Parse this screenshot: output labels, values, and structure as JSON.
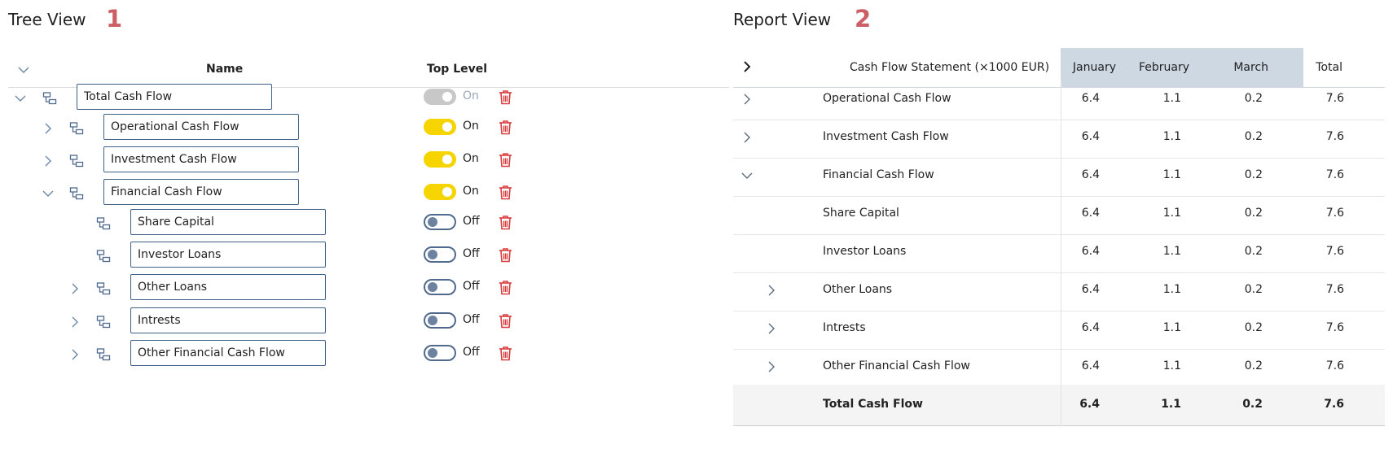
{
  "tree_view": {
    "title": "Tree View",
    "number": "1",
    "header": {
      "name": "Name",
      "top_level": "Top Level"
    },
    "rows": [
      {
        "label": "Total Cash Flow",
        "depth": 0,
        "chevron": "chevron-down",
        "toggle": "disabled",
        "toggle_label": "On"
      },
      {
        "label": "Operational Cash Flow",
        "depth": 1,
        "chevron": "chevron-right",
        "toggle": "on",
        "toggle_label": "On"
      },
      {
        "label": "Investment Cash Flow",
        "depth": 1,
        "chevron": "chevron-right",
        "toggle": "on",
        "toggle_label": "On"
      },
      {
        "label": "Financial Cash Flow",
        "depth": 1,
        "chevron": "chevron-down",
        "toggle": "on",
        "toggle_label": "On"
      },
      {
        "label": "Share Capital",
        "depth": 2,
        "chevron": "none",
        "toggle": "off",
        "toggle_label": "Off"
      },
      {
        "label": "Investor Loans",
        "depth": 2,
        "chevron": "none",
        "toggle": "off",
        "toggle_label": "Off"
      },
      {
        "label": "Other Loans",
        "depth": 2,
        "chevron": "chevron-right",
        "toggle": "off",
        "toggle_label": "Off"
      },
      {
        "label": "Intrests",
        "depth": 2,
        "chevron": "chevron-right",
        "toggle": "off",
        "toggle_label": "Off"
      },
      {
        "label": "Other Financial Cash Flow",
        "depth": 2,
        "chevron": "chevron-right",
        "toggle": "off",
        "toggle_label": "Off"
      }
    ]
  },
  "report_view": {
    "title": "Report View",
    "number": "2",
    "columns": {
      "statement": "Cash Flow Statement (×1000 EUR)",
      "jan": "January",
      "feb": "February",
      "mar": "March",
      "total": "Total"
    },
    "rows": [
      {
        "label": "Operational Cash Flow",
        "chevron": "chevron-right",
        "indent": 0,
        "jan": "6.4",
        "feb": "1.1",
        "mar": "0.2",
        "total": "7.6"
      },
      {
        "label": "Investment Cash Flow",
        "chevron": "chevron-right",
        "indent": 0,
        "jan": "6.4",
        "feb": "1.1",
        "mar": "0.2",
        "total": "7.6"
      },
      {
        "label": "Financial Cash Flow",
        "chevron": "chevron-down",
        "indent": 0,
        "jan": "6.4",
        "feb": "1.1",
        "mar": "0.2",
        "total": "7.6"
      },
      {
        "label": "Share Capital",
        "chevron": "none",
        "indent": 1,
        "jan": "6.4",
        "feb": "1.1",
        "mar": "0.2",
        "total": "7.6"
      },
      {
        "label": "Investor Loans",
        "chevron": "none",
        "indent": 1,
        "jan": "6.4",
        "feb": "1.1",
        "mar": "0.2",
        "total": "7.6"
      },
      {
        "label": "Other Loans",
        "chevron": "chevron-right",
        "indent": 1,
        "jan": "6.4",
        "feb": "1.1",
        "mar": "0.2",
        "total": "7.6"
      },
      {
        "label": "Intrests",
        "chevron": "chevron-right",
        "indent": 1,
        "jan": "6.4",
        "feb": "1.1",
        "mar": "0.2",
        "total": "7.6"
      },
      {
        "label": "Other Financial Cash Flow",
        "chevron": "chevron-right",
        "indent": 1,
        "jan": "6.4",
        "feb": "1.1",
        "mar": "0.2",
        "total": "7.6"
      }
    ],
    "total_row": {
      "label": "Total Cash Flow",
      "jan": "6.4",
      "feb": "1.1",
      "mar": "0.2",
      "total": "7.6"
    }
  },
  "colors": {
    "accent_number": "#cc5f66",
    "toggle_on": "#f5d400",
    "toggle_off_border": "#4f6a8d",
    "trash": "#d83b3b",
    "month_band": "#cdd8e3",
    "input_border": "#3f5f86"
  }
}
